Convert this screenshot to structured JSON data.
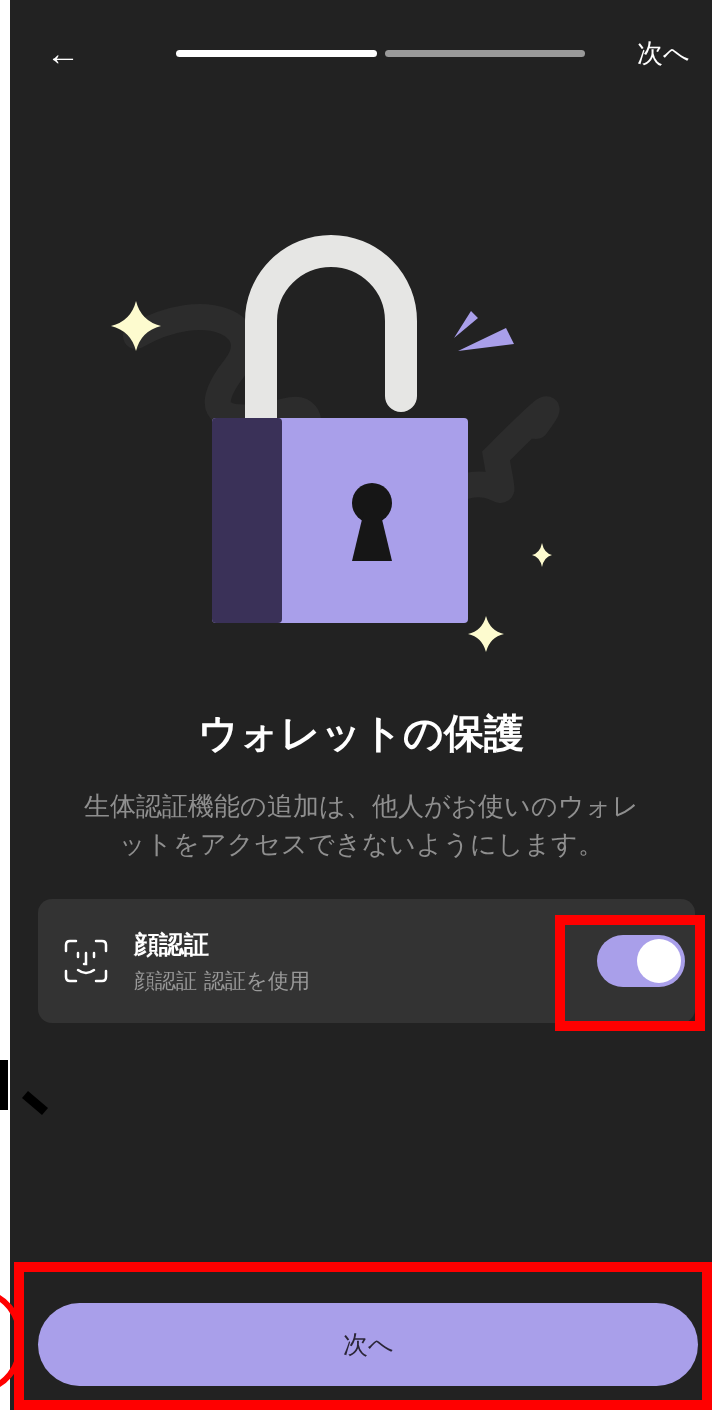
{
  "top_bar": {
    "back": "←",
    "steps": [
      {
        "completed": true
      },
      {
        "completed": false
      }
    ],
    "next": "次へ"
  },
  "title": "ウォレットの保護",
  "description": "生体認証機能の追加は、他人がお使いのウォレットをアクセスできないようにします。",
  "setting": {
    "title": "顔認証",
    "subtitle": "顔認証 認証を使用",
    "on": true
  },
  "button": "次へ"
}
